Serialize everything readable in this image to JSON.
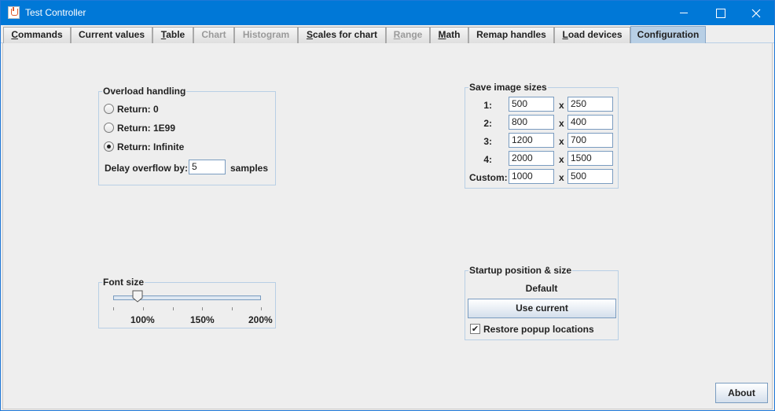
{
  "window": {
    "title": "Test Controller"
  },
  "tabs": [
    {
      "label": "Commands",
      "mnemonic": "C",
      "rest": "ommands",
      "enabled": true,
      "active": false
    },
    {
      "label": "Current values",
      "mnemonic": "",
      "rest": "Current values",
      "enabled": true,
      "active": false
    },
    {
      "label": "Table",
      "mnemonic": "T",
      "rest": "able",
      "enabled": true,
      "active": false
    },
    {
      "label": "Chart",
      "mnemonic": "",
      "rest": "Chart",
      "enabled": false,
      "active": false
    },
    {
      "label": "Histogram",
      "mnemonic": "",
      "rest": "Histogram",
      "enabled": false,
      "active": false
    },
    {
      "label": "Scales for chart",
      "mnemonic": "S",
      "rest": "cales for chart",
      "enabled": true,
      "active": false
    },
    {
      "label": "Range",
      "mnemonic": "R",
      "rest": "ange",
      "enabled": false,
      "active": false
    },
    {
      "label": "Math",
      "mnemonic": "M",
      "rest": "ath",
      "enabled": true,
      "active": false
    },
    {
      "label": "Remap handles",
      "mnemonic": "",
      "rest": "Remap handles",
      "enabled": true,
      "active": false
    },
    {
      "label": "Load devices",
      "mnemonic": "L",
      "rest": "oad devices",
      "enabled": true,
      "active": false
    },
    {
      "label": "Configuration",
      "mnemonic": "",
      "rest": "Configuration",
      "enabled": true,
      "active": true
    }
  ],
  "overload": {
    "title": "Overload handling",
    "options": [
      {
        "label": "Return: 0",
        "checked": false
      },
      {
        "label": "Return: 1E99",
        "checked": false
      },
      {
        "label": "Return: Infinite",
        "checked": true
      }
    ],
    "delay_label": "Delay overflow by:",
    "delay_value": "5",
    "delay_unit": "samples"
  },
  "image_sizes": {
    "title": "Save image sizes",
    "separator": "x",
    "rows": [
      {
        "label": "1:",
        "width": "500",
        "height": "250"
      },
      {
        "label": "2:",
        "width": "800",
        "height": "400"
      },
      {
        "label": "3:",
        "width": "1200",
        "height": "700"
      },
      {
        "label": "4:",
        "width": "2000",
        "height": "1500"
      },
      {
        "label": "Custom:",
        "width": "1000",
        "height": "500"
      }
    ]
  },
  "font_size": {
    "title": "Font size",
    "labels": [
      "100%",
      "150%",
      "200%"
    ],
    "value_percent": 100,
    "min_percent": 80,
    "max_percent": 200
  },
  "startup": {
    "title": "Startup position & size",
    "value": "Default",
    "use_current_label": "Use current",
    "restore_label": "Restore popup locations",
    "restore_checked": true
  },
  "about_label": "About",
  "colors": {
    "titlebar": "#0078d7",
    "active_tab": "#b8cfe5",
    "border_accent": "#7a9cc0"
  }
}
